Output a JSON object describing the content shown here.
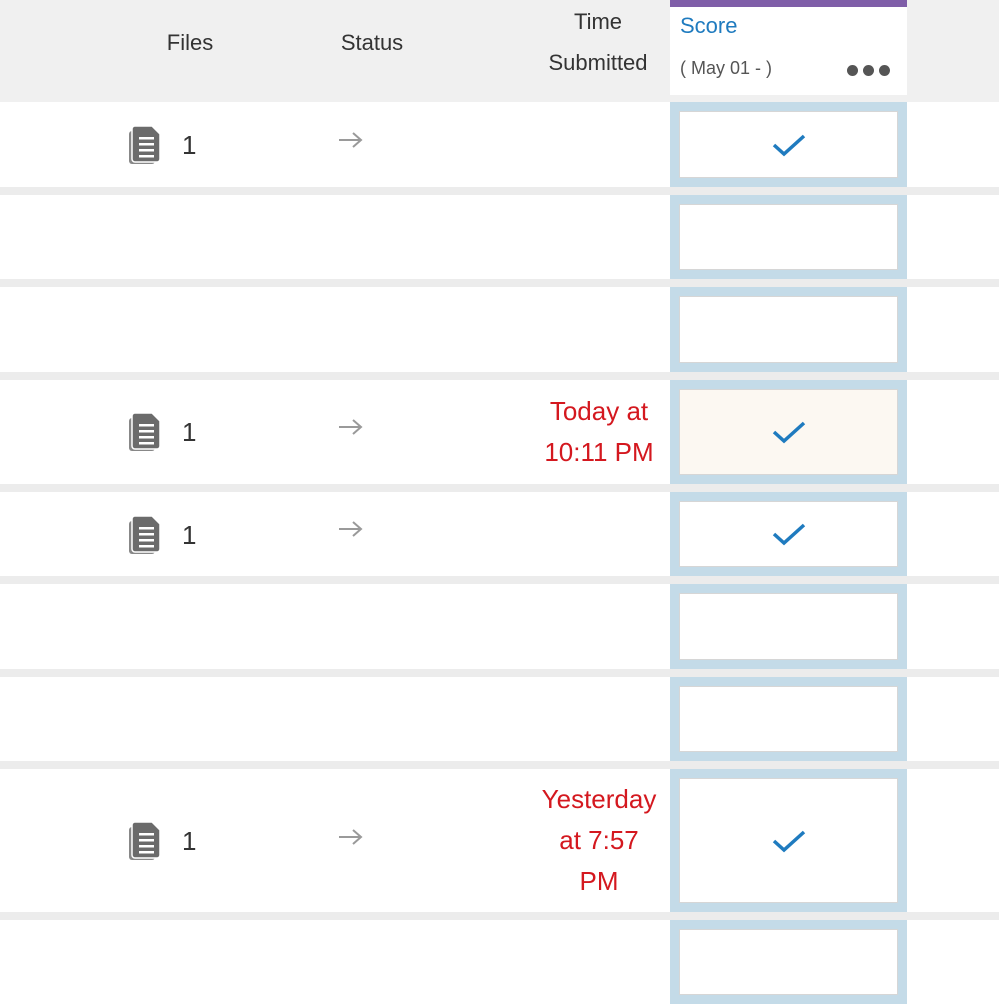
{
  "header": {
    "files_label": "Files",
    "status_label": "Status",
    "time_label_line1": "Time",
    "time_label_line2": "Submitted"
  },
  "score_column": {
    "title": "Score",
    "date_range": "( May 01 - )",
    "menu_icon": "more-horizontal-icon",
    "accent_color": "#7f5ea8",
    "title_color": "#1f7bbf"
  },
  "rows": [
    {
      "files": "1",
      "has_files": true,
      "status_icon": "arrow-right-icon",
      "time": "",
      "score_checked": true
    },
    {
      "files": "",
      "has_files": false,
      "status_icon": "",
      "time": "",
      "score_checked": false
    },
    {
      "files": "",
      "has_files": false,
      "status_icon": "",
      "time": "",
      "score_checked": false
    },
    {
      "files": "1",
      "has_files": true,
      "status_icon": "arrow-right-icon",
      "time_lines": [
        "Today at",
        "10:11 PM"
      ],
      "score_checked": true,
      "highlighted": true
    },
    {
      "files": "1",
      "has_files": true,
      "status_icon": "arrow-right-icon",
      "time": "",
      "score_checked": true
    },
    {
      "files": "",
      "has_files": false,
      "status_icon": "",
      "time": "",
      "score_checked": false
    },
    {
      "files": "",
      "has_files": false,
      "status_icon": "",
      "time": "",
      "score_checked": false
    },
    {
      "files": "1",
      "has_files": true,
      "status_icon": "arrow-right-icon",
      "time_lines": [
        "Yesterday",
        "at 7:57",
        "PM"
      ],
      "score_checked": true
    },
    {
      "files": "",
      "has_files": false,
      "status_icon": "",
      "time": "",
      "score_checked": false
    }
  ],
  "colors": {
    "late_time": "#d4181f",
    "check": "#1f7bbf",
    "score_cell_bg": "#c4dbe8",
    "row_separator": "#ececec"
  }
}
